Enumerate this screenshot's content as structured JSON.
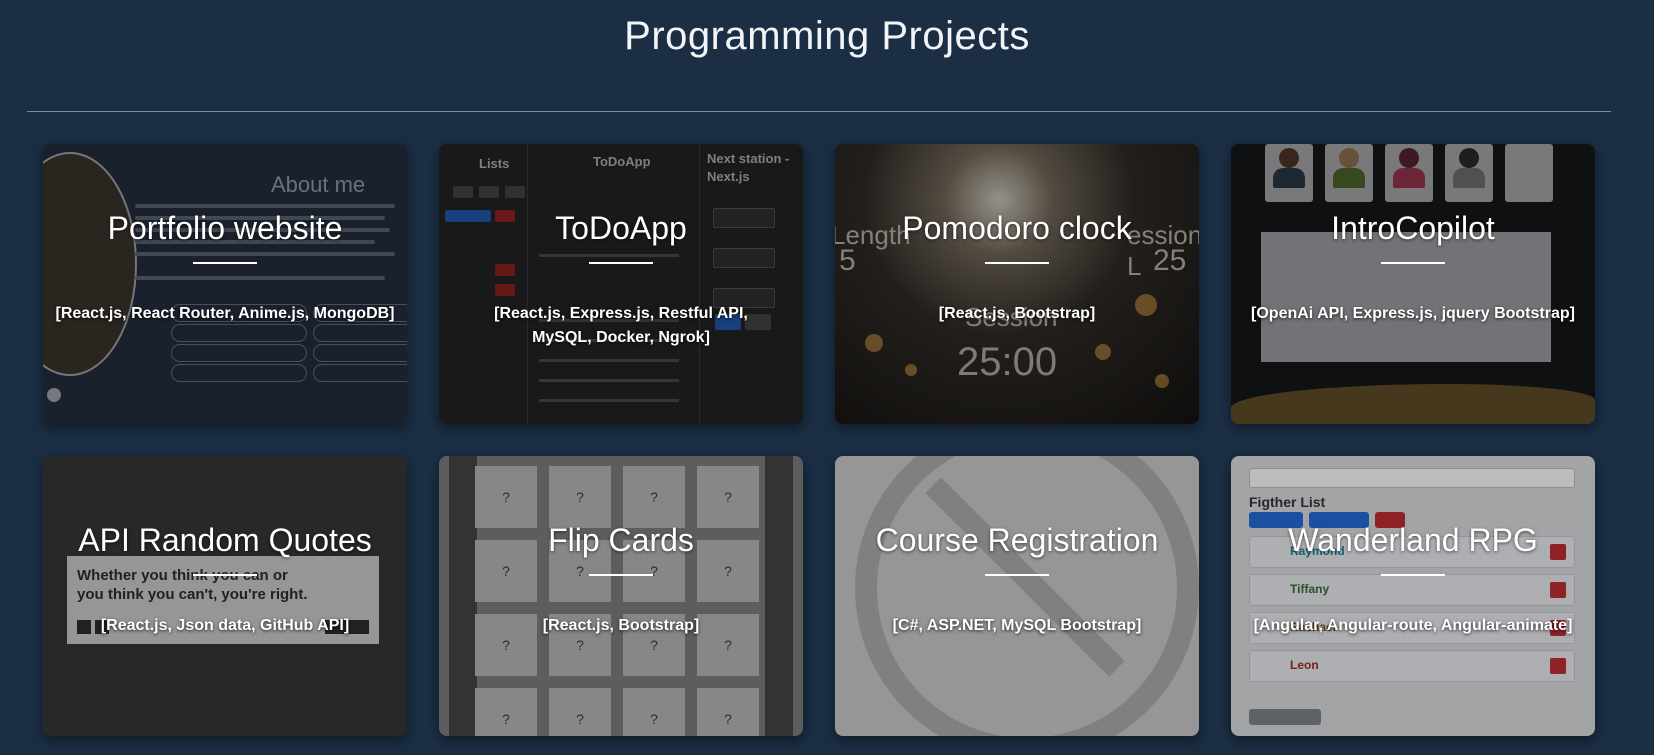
{
  "page": {
    "title": "Programming Projects"
  },
  "projects": [
    {
      "title": "Portfolio website",
      "tech": "[React.js, React Router, Anime.js, MongoDB]"
    },
    {
      "title": "ToDoApp",
      "tech": "[React.js, Express.js, Restful API, MySQL, Docker, Ngrok]"
    },
    {
      "title": "Pomodoro clock",
      "tech": "[React.js, Bootstrap]"
    },
    {
      "title": "IntroCopilot",
      "tech": "[OpenAi API, Express.js, jquery Bootstrap]"
    },
    {
      "title": "API Random Quotes",
      "tech": "[React.js, Json data, GitHub API]"
    },
    {
      "title": "Flip Cards",
      "tech": "[React.js, Bootstrap]"
    },
    {
      "title": "Course Registration",
      "tech": "[C#, ASP.NET, MySQL Bootstrap]"
    },
    {
      "title": "Wanderland RPG",
      "tech": "[Angular, Angular-route, Angular-animate]"
    }
  ],
  "previews": {
    "portfolio": {
      "heading": "About me"
    },
    "todo": {
      "lists": "Lists",
      "app": "ToDoApp",
      "side": "Next station - Next.js"
    },
    "pomodoro": {
      "left": "Length",
      "right": "ession L",
      "session": "Session",
      "time": "25:00",
      "num_left": "5",
      "num_right": "25"
    },
    "quotes": {
      "quote": "Whether you think you can or you think you can't, you're right."
    },
    "flip": {
      "tile": "?"
    },
    "rpg": {
      "heading": "Figther List",
      "fighters": [
        "Raymond",
        "Tiffany",
        "Rachael",
        "Leon"
      ]
    }
  },
  "colors": {
    "background": "#1b2e44",
    "divider": "#7c8ea3",
    "text": "#ffffff"
  }
}
